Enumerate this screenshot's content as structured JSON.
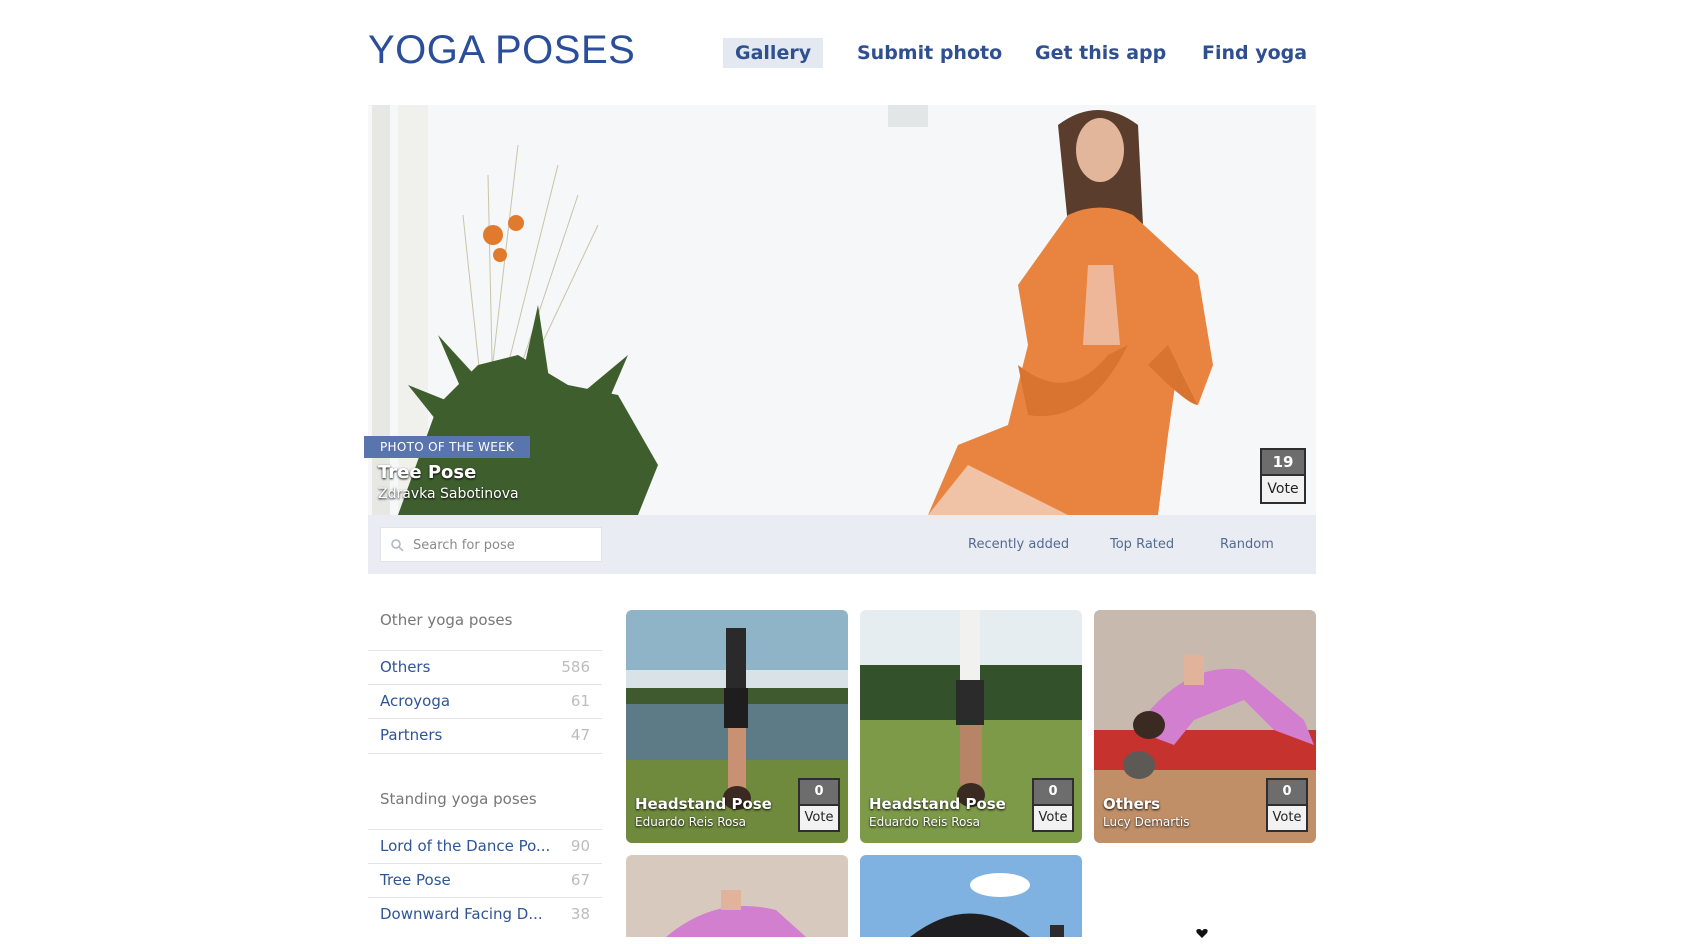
{
  "header": {
    "logo": "YOGA POSES",
    "nav": [
      {
        "label": "Gallery",
        "active": true
      },
      {
        "label": "Submit photo"
      },
      {
        "label": "Get this app"
      },
      {
        "label": "Find yoga"
      }
    ]
  },
  "hero": {
    "badge": "PHOTO  OF THE WEEK",
    "title": "Tree Pose",
    "author": "Zdravka Sabotinova",
    "votes": "19",
    "vote_label": "Vote"
  },
  "toolbar": {
    "search_placeholder": "Search for pose",
    "sort": [
      "Recently added",
      "Top Rated",
      "Random"
    ]
  },
  "sidebar": {
    "groups": [
      {
        "heading": "Other yoga poses",
        "items": [
          {
            "name": "Others",
            "count": "586"
          },
          {
            "name": "Acroyoga",
            "count": "61"
          },
          {
            "name": "Partners",
            "count": "47"
          }
        ]
      },
      {
        "heading": "Standing yoga poses",
        "items": [
          {
            "name": "Lord of the Dance Po...",
            "count": "90"
          },
          {
            "name": "Tree Pose",
            "count": "67"
          },
          {
            "name": "Downward Facing D...",
            "count": "38"
          }
        ]
      }
    ]
  },
  "gallery": {
    "tiles": [
      {
        "title": "Headstand Pose",
        "author": "Eduardo Reis Rosa",
        "votes": "0",
        "vote_label": "Vote"
      },
      {
        "title": "Headstand Pose",
        "author": "Eduardo Reis Rosa",
        "votes": "0",
        "vote_label": "Vote"
      },
      {
        "title": "Others",
        "author": "Lucy Demartis",
        "votes": "0",
        "vote_label": "Vote"
      }
    ]
  },
  "colors": {
    "brand": "#2b4e9a",
    "link": "#2f5597",
    "badge": "#5a74ad",
    "toolbar_bg": "#e9ecf3"
  }
}
